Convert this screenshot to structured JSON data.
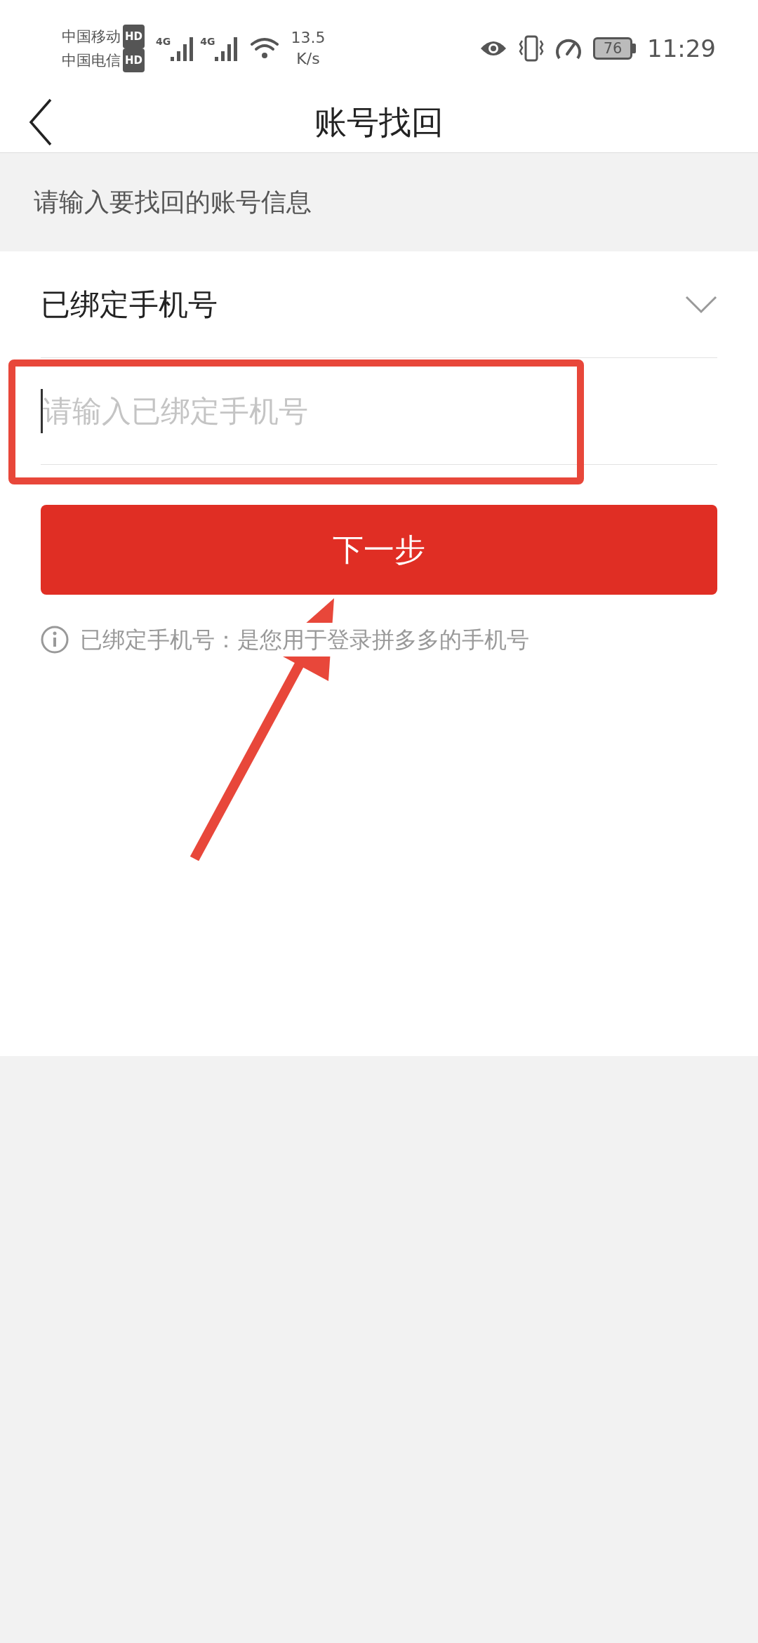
{
  "status_bar": {
    "carriers": [
      {
        "name": "中国移动",
        "badge": "HD"
      },
      {
        "name": "中国电信",
        "badge": "HD"
      }
    ],
    "network_labels": [
      "4G",
      "4G"
    ],
    "speed": "13.5",
    "speed_unit": "K/s",
    "battery": "76",
    "time": "11:29"
  },
  "header": {
    "title": "账号找回"
  },
  "section_label": "请输入要找回的账号信息",
  "dropdown": {
    "value": "已绑定手机号",
    "expanded": false
  },
  "phone_field": {
    "placeholder": "请输入已绑定手机号"
  },
  "next_button": "下一步",
  "hint": "已绑定手机号：是您用于登录拼多多的手机号"
}
